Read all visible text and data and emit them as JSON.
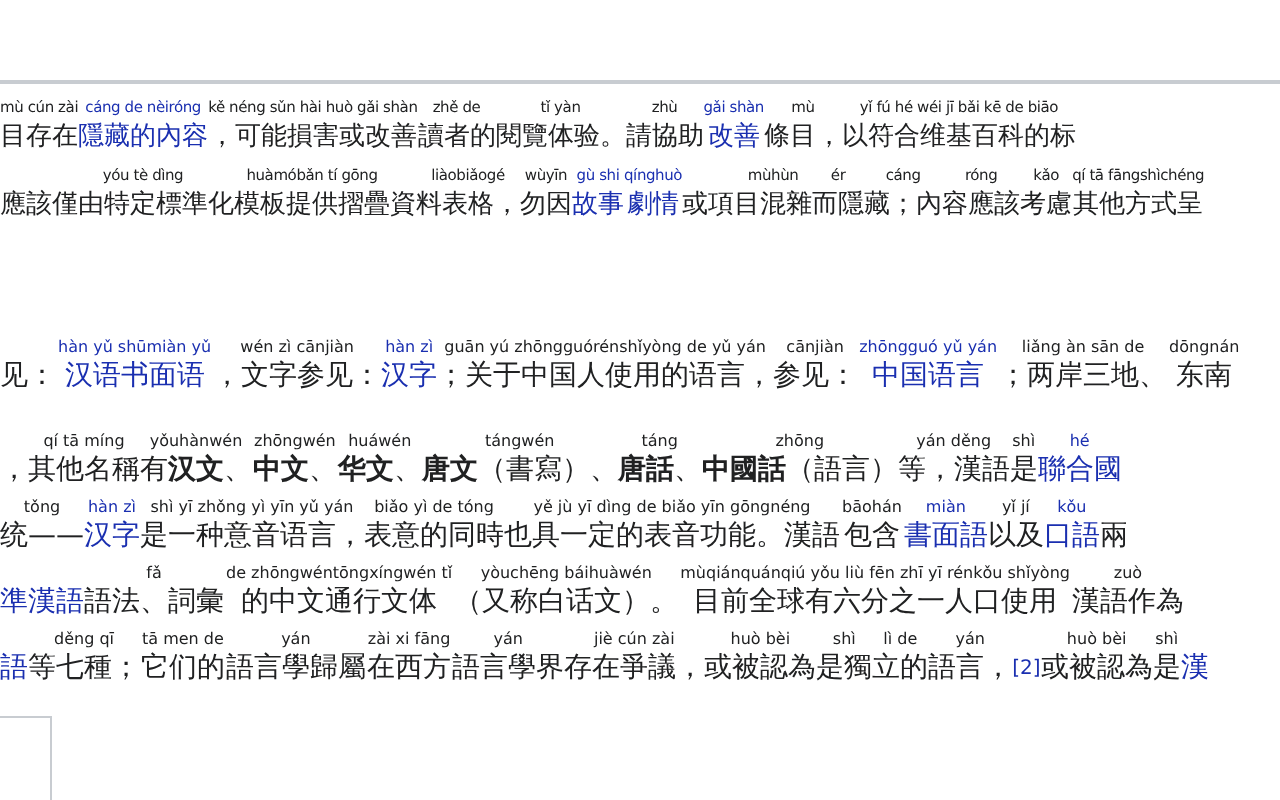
{
  "notice": {
    "lines": [
      [
        {
          "py": "mù cún zài",
          "zh": "目存在",
          "kind": "text"
        },
        {
          "py": "cáng de nèiróng",
          "zh": "隱藏的內容",
          "kind": "link"
        },
        {
          "py": "kě néng sǔn hài huò gǎi shàn",
          "zh": "，可能損害或改善",
          "kind": "text"
        },
        {
          "py": "zhě de",
          "zh": "讀者的",
          "kind": "text"
        },
        {
          "py": "tǐ yàn",
          "zh": "閱覽体验。",
          "kind": "text"
        },
        {
          "py": "zhù",
          "zh": "請協助",
          "kind": "text"
        },
        {
          "py": "gǎi shàn",
          "zh": "改善",
          "kind": "link"
        },
        {
          "py": "mù",
          "zh": "條目，",
          "kind": "text"
        },
        {
          "py": "yǐ fú hé wéi jī bǎi kē de biāo",
          "zh": "以符合维基百科的标",
          "kind": "text"
        }
      ],
      [
        {
          "zh": "應該僅",
          "kind": "text"
        },
        {
          "py": "yóu tè dìng",
          "zh": "由特定標準",
          "kind": "text"
        },
        {
          "py": "huàmóbǎn tí gōng",
          "zh": "化模板提供摺疊資",
          "kind": "text"
        },
        {
          "py": "liàobiǎogé",
          "zh": "料表格，",
          "kind": "text"
        },
        {
          "py": "wùyīn",
          "zh": "勿因",
          "kind": "text"
        },
        {
          "py": "gù shi",
          "zh": "故事",
          "kind": "link"
        },
        {
          "py": "qínghuò",
          "zh": "劇情",
          "kind": "link"
        },
        {
          "zh": "或項",
          "kind": "text"
        },
        {
          "py": "mùhùn",
          "zh": "目混雜",
          "kind": "text"
        },
        {
          "py": "ér",
          "zh": "而隱",
          "kind": "text"
        },
        {
          "py": "cáng",
          "zh": "藏；內",
          "kind": "text"
        },
        {
          "py": "róng",
          "zh": "容應該",
          "kind": "text"
        },
        {
          "py": "kǎo",
          "zh": "考慮",
          "kind": "text"
        },
        {
          "py": "qí tā fāngshìchéng",
          "zh": "其他方式呈",
          "kind": "text"
        }
      ]
    ]
  },
  "hatnote": [
    {
      "zh": "见：",
      "kind": "text"
    },
    {
      "py": "hàn yǔ shūmiàn yǔ",
      "zh": "汉语书面语",
      "kind": "link"
    },
    {
      "py": "wén zì cānjiàn",
      "zh": "，文字参见：",
      "kind": "text"
    },
    {
      "py": "hàn zì",
      "zh": "汉字",
      "kind": "link"
    },
    {
      "py": "guān yú zhōngguórénshǐyòng de yǔ yán",
      "zh": "；关于中国人使用的语言，",
      "kind": "text"
    },
    {
      "py": "cānjiàn",
      "zh": "参见：",
      "kind": "text"
    },
    {
      "py": "zhōngguó yǔ yán",
      "zh": "中国语言",
      "kind": "link"
    },
    {
      "py": "liǎng àn sān de",
      "zh": "；两岸三地、",
      "kind": "text"
    },
    {
      "py": "dōngnán",
      "zh": "东南",
      "kind": "text"
    }
  ],
  "paragraph": [
    [
      {
        "zh": "，",
        "kind": "text"
      },
      {
        "py": "qí tā míng",
        "zh": "其他名稱",
        "kind": "text"
      },
      {
        "py": "yǒuhànwén",
        "zh": "有**汉文**、",
        "kind": "text"
      },
      {
        "py": "zhōngwén",
        "zh": "**中文**、",
        "kind": "text"
      },
      {
        "py": "huáwén",
        "zh": "**华文**、",
        "kind": "text"
      },
      {
        "py": "tángwén",
        "zh": "**唐文**（書寫）、",
        "kind": "text"
      },
      {
        "py": "táng",
        "zh": "**唐話**、",
        "kind": "text"
      },
      {
        "py": "zhōng",
        "zh": "**中國話**（語言）",
        "kind": "text"
      },
      {
        "py": "yán děng",
        "zh": "等，漢語",
        "kind": "text"
      },
      {
        "py": "shì",
        "zh": "是",
        "kind": "text"
      },
      {
        "py": "hé",
        "zh": "聯合國",
        "kind": "link"
      }
    ],
    [
      {
        "py": "tǒng",
        "zh": "统——",
        "kind": "text"
      },
      {
        "py": "hàn zì",
        "zh": "汉字",
        "kind": "link"
      },
      {
        "py": "shì yī zhǒng yì yīn yǔ yán",
        "zh": "是一种意音语言，",
        "kind": "text"
      },
      {
        "py": "biǎo yì de tóng",
        "zh": "表意的同時",
        "kind": "text"
      },
      {
        "py": "yě jù yī dìng de biǎo yīn gōngnéng",
        "zh": "也具一定的表音功能。漢語",
        "kind": "text"
      },
      {
        "py": "bāohán",
        "zh": "包含",
        "kind": "text"
      },
      {
        "py": "miàn",
        "zh": "書面語",
        "kind": "link"
      },
      {
        "py": "yǐ jí",
        "zh": "以及",
        "kind": "text"
      },
      {
        "py": "kǒu",
        "zh": "口語",
        "kind": "link"
      },
      {
        "zh": "兩",
        "kind": "text"
      }
    ],
    [
      {
        "zh": "準漢語",
        "kind": "link"
      },
      {
        "py": "fǎ",
        "zh": "語法、詞彙",
        "kind": "text"
      },
      {
        "py": "de zhōngwéntōngxíngwén tǐ",
        "zh": "的中文通行文体",
        "kind": "text"
      },
      {
        "py": "yòuchēng báihuàwén",
        "zh": "（又称白话文）。",
        "kind": "text"
      },
      {
        "py": "mùqiánquánqiú yǒu liù fēn zhī yī rénkǒu shǐyòng",
        "zh": "目前全球有六分之一人口使用",
        "kind": "text"
      },
      {
        "py": "zuò",
        "zh": "漢語作為",
        "kind": "text"
      }
    ],
    [
      {
        "zh": "語",
        "kind": "link"
      },
      {
        "py": "děng qī",
        "zh": "等七種；",
        "kind": "text"
      },
      {
        "py": "tā men de",
        "zh": "它们的",
        "kind": "text"
      },
      {
        "py": "yán",
        "zh": "語言學歸屬",
        "kind": "text"
      },
      {
        "py": "zài xi fāng",
        "zh": "在西方",
        "kind": "text"
      },
      {
        "py": "yán",
        "zh": "語言學界",
        "kind": "text"
      },
      {
        "py": "jiè cún zài",
        "zh": "存在爭議，",
        "kind": "text"
      },
      {
        "py": "huò bèi",
        "zh": "或被認為",
        "kind": "text"
      },
      {
        "py": "shì",
        "zh": "是獨",
        "kind": "text"
      },
      {
        "py": "lì de",
        "zh": "立的",
        "kind": "text"
      },
      {
        "py": "yán",
        "zh": "語言，",
        "kind": "text"
      },
      {
        "zh": "[2]",
        "kind": "ref"
      },
      {
        "py": "huò bèi",
        "zh": "或被認為",
        "kind": "text"
      },
      {
        "py": "shì",
        "zh": "是",
        "kind": "text"
      },
      {
        "zh": "漢",
        "kind": "link"
      }
    ]
  ]
}
